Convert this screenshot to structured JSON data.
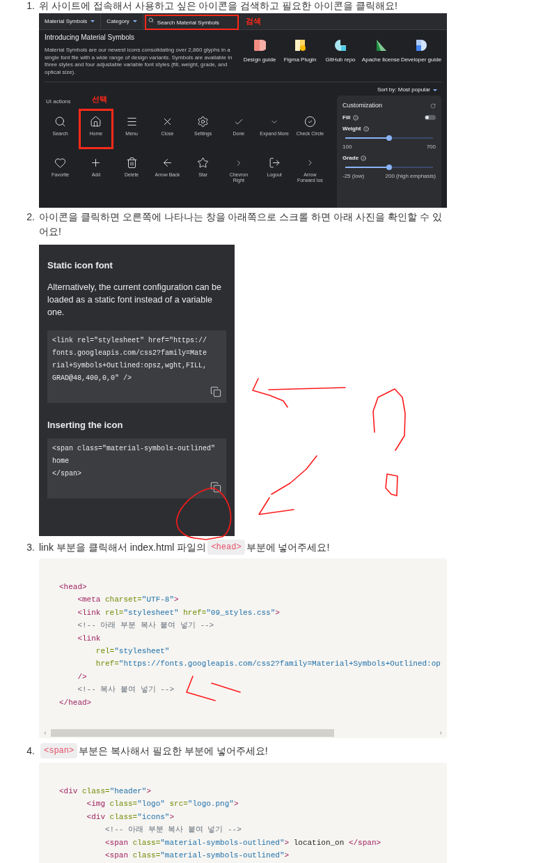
{
  "step_1": {
    "marker": "1.",
    "text": "위 사이트에 접속해서 사용하고 싶은 아이콘을 검색하고 필요한 아이콘을 클릭해요!"
  },
  "material_site": {
    "menus": [
      {
        "label": "Material Symbols"
      },
      {
        "label": "Category"
      }
    ],
    "search": {
      "placeholder": "Search Material Symbols"
    },
    "search_note": "검색",
    "title": "Introducing Material Symbols",
    "description": "Material Symbols are our newest icons consolidating over 2,860 glyphs in a single font file with a wide range of design variants. Symbols are available in three styles and four adjustable variable font styles (fill, weight, grade, and optical size).",
    "resources": [
      {
        "label": "Design guide"
      },
      {
        "label": "Figma Plugin"
      },
      {
        "label": "GitHub repo"
      },
      {
        "label": "Apache license"
      },
      {
        "label": "Developer guide"
      }
    ],
    "sort": "Sort by: Most popular",
    "section": "UI actions",
    "select_note": "선택",
    "icons": [
      {
        "label": "Search",
        "selected": false
      },
      {
        "label": "Home",
        "selected": true
      },
      {
        "label": "Menu",
        "selected": false
      },
      {
        "label": "Close",
        "selected": false
      },
      {
        "label": "Settings",
        "selected": false
      },
      {
        "label": "Done",
        "selected": false
      },
      {
        "label": "Expand More",
        "selected": false
      },
      {
        "label": "Check Circle",
        "selected": false
      },
      {
        "label": "Favorite",
        "selected": false
      },
      {
        "label": "Add",
        "selected": false
      },
      {
        "label": "Delete",
        "selected": false
      },
      {
        "label": "Arrow Back",
        "selected": false
      },
      {
        "label": "Star",
        "selected": false
      },
      {
        "label": "Chevron Right",
        "selected": false
      },
      {
        "label": "Logout",
        "selected": false
      },
      {
        "label": "Arrow Forward Ios",
        "selected": false
      }
    ],
    "customization": {
      "title": "Customization",
      "fill": {
        "label": "Fill",
        "on": false
      },
      "weight": {
        "label": "Weight",
        "level": 0.5,
        "min": "100",
        "max": "700"
      },
      "grade": {
        "label": "Grade",
        "level": 0.5,
        "min": "-25 (low)",
        "max": "200 (high emphasis)"
      }
    }
  },
  "step_2": {
    "marker": "2.",
    "text": "아이콘을 클릭하면 오른쪽에 나타나는 창을 아래쪽으로 스크롤 하면 아래 사진을 확인할 수 있어요!"
  },
  "icon_panel": {
    "title": "Static icon font",
    "description": "Alternatively, the current configuration can be loaded as a static font instead of a variable one.",
    "static_code": [
      "<link rel=\"stylesheet\" href=\"https://",
      "fonts.googleapis.com/css2?family=Mate",
      "rial+Symbols+Outlined:opsz,wght,FILL,",
      "GRAD@48,400,0,0\" />"
    ],
    "insert_title": "Inserting the icon",
    "insert_code": [
      "<span class=\"material-symbols-outlined\"",
      "home",
      "</span>"
    ]
  },
  "step_3": {
    "marker": "3.",
    "before": "link 부분을 클릭해서 index.html 파일의",
    "code": "<head>",
    "after": "부분에 넣어주세요!"
  },
  "head_code": [
    [
      {
        "kind": "tag",
        "text": "<head>"
      }
    ],
    [
      {
        "kind": "tag",
        "text": "    <meta"
      },
      {
        "kind": "attr",
        "text": " charset="
      },
      {
        "kind": "value",
        "text": "\"UTF-8\""
      },
      {
        "kind": "tag",
        "text": ">"
      }
    ],
    [
      {
        "kind": "tag",
        "text": "    <link"
      },
      {
        "kind": "attr",
        "text": " rel="
      },
      {
        "kind": "value",
        "text": "\"stylesheet\""
      },
      {
        "kind": "attr",
        "text": " href="
      },
      {
        "kind": "value",
        "text": "\"09_styles.css\""
      },
      {
        "kind": "tag",
        "text": ">"
      }
    ],
    [
      {
        "kind": "comment",
        "text": "    <!-- 아래 부분 복사 붙여 넣기 -->"
      }
    ],
    [
      {
        "kind": "tag",
        "text": "    <link"
      }
    ],
    [
      {
        "kind": "attr",
        "text": "        rel="
      },
      {
        "kind": "value",
        "text": "\"stylesheet\""
      }
    ],
    [
      {
        "kind": "attr",
        "text": "        href="
      },
      {
        "kind": "value",
        "text": "\"https://fonts.googleapis.com/css2?family=Material+Symbols+Outlined:op"
      }
    ],
    [
      {
        "kind": "tag",
        "text": "    />"
      }
    ],
    [
      {
        "kind": "comment",
        "text": "    <!-- 복사 붙여 넣기 -->"
      }
    ],
    [
      {
        "kind": "tag",
        "text": "</head>"
      }
    ]
  ],
  "step_4": {
    "marker": "4.",
    "code": "<span>",
    "after": "부분은 복사해서 필요한 부분에 넣어주세요!"
  },
  "header_code": [
    [
      {
        "kind": "tag",
        "text": "<div"
      },
      {
        "kind": "attr",
        "text": " class="
      },
      {
        "kind": "value",
        "text": "\"header\""
      },
      {
        "kind": "tag",
        "text": ">"
      }
    ],
    [
      {
        "kind": "tag",
        "text": "      <img"
      },
      {
        "kind": "attr",
        "text": " class="
      },
      {
        "kind": "value",
        "text": "\"logo\""
      },
      {
        "kind": "attr",
        "text": " src="
      },
      {
        "kind": "value",
        "text": "\"logo.png\""
      },
      {
        "kind": "tag",
        "text": ">"
      }
    ],
    [
      {
        "kind": "tag",
        "text": "      <div"
      },
      {
        "kind": "attr",
        "text": " class="
      },
      {
        "kind": "value",
        "text": "\"icons\""
      },
      {
        "kind": "tag",
        "text": ">"
      }
    ],
    [
      {
        "kind": "comment",
        "text": "          <!-- 아래 부분 복사 붙여 넣기 -->"
      }
    ],
    [
      {
        "kind": "tag",
        "text": "          <span"
      },
      {
        "kind": "attr",
        "text": " class="
      },
      {
        "kind": "value",
        "text": "\"material-symbols-outlined\""
      },
      {
        "kind": "tag",
        "text": ">"
      },
      {
        "kind": "text",
        "text": " location_on "
      },
      {
        "kind": "tag",
        "text": "</span>"
      }
    ],
    [
      {
        "kind": "tag",
        "text": "          <span"
      },
      {
        "kind": "attr",
        "text": " class="
      },
      {
        "kind": "value",
        "text": "\"material-symbols-outlined\""
      },
      {
        "kind": "tag",
        "text": ">"
      }
    ]
  ]
}
